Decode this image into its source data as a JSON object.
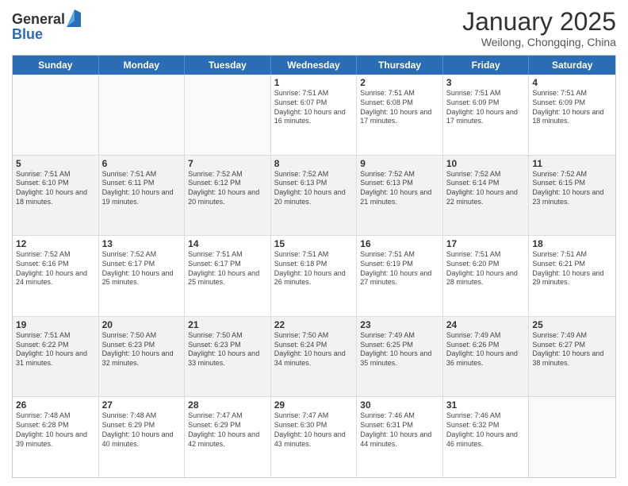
{
  "header": {
    "logo_general": "General",
    "logo_blue": "Blue",
    "month_title": "January 2025",
    "location": "Weilong, Chongqing, China"
  },
  "weekdays": [
    "Sunday",
    "Monday",
    "Tuesday",
    "Wednesday",
    "Thursday",
    "Friday",
    "Saturday"
  ],
  "rows": [
    [
      {
        "day": "",
        "info": ""
      },
      {
        "day": "",
        "info": ""
      },
      {
        "day": "",
        "info": ""
      },
      {
        "day": "1",
        "info": "Sunrise: 7:51 AM\nSunset: 6:07 PM\nDaylight: 10 hours and 16 minutes."
      },
      {
        "day": "2",
        "info": "Sunrise: 7:51 AM\nSunset: 6:08 PM\nDaylight: 10 hours and 17 minutes."
      },
      {
        "day": "3",
        "info": "Sunrise: 7:51 AM\nSunset: 6:09 PM\nDaylight: 10 hours and 17 minutes."
      },
      {
        "day": "4",
        "info": "Sunrise: 7:51 AM\nSunset: 6:09 PM\nDaylight: 10 hours and 18 minutes."
      }
    ],
    [
      {
        "day": "5",
        "info": "Sunrise: 7:51 AM\nSunset: 6:10 PM\nDaylight: 10 hours and 18 minutes."
      },
      {
        "day": "6",
        "info": "Sunrise: 7:51 AM\nSunset: 6:11 PM\nDaylight: 10 hours and 19 minutes."
      },
      {
        "day": "7",
        "info": "Sunrise: 7:52 AM\nSunset: 6:12 PM\nDaylight: 10 hours and 20 minutes."
      },
      {
        "day": "8",
        "info": "Sunrise: 7:52 AM\nSunset: 6:13 PM\nDaylight: 10 hours and 20 minutes."
      },
      {
        "day": "9",
        "info": "Sunrise: 7:52 AM\nSunset: 6:13 PM\nDaylight: 10 hours and 21 minutes."
      },
      {
        "day": "10",
        "info": "Sunrise: 7:52 AM\nSunset: 6:14 PM\nDaylight: 10 hours and 22 minutes."
      },
      {
        "day": "11",
        "info": "Sunrise: 7:52 AM\nSunset: 6:15 PM\nDaylight: 10 hours and 23 minutes."
      }
    ],
    [
      {
        "day": "12",
        "info": "Sunrise: 7:52 AM\nSunset: 6:16 PM\nDaylight: 10 hours and 24 minutes."
      },
      {
        "day": "13",
        "info": "Sunrise: 7:52 AM\nSunset: 6:17 PM\nDaylight: 10 hours and 25 minutes."
      },
      {
        "day": "14",
        "info": "Sunrise: 7:51 AM\nSunset: 6:17 PM\nDaylight: 10 hours and 25 minutes."
      },
      {
        "day": "15",
        "info": "Sunrise: 7:51 AM\nSunset: 6:18 PM\nDaylight: 10 hours and 26 minutes."
      },
      {
        "day": "16",
        "info": "Sunrise: 7:51 AM\nSunset: 6:19 PM\nDaylight: 10 hours and 27 minutes."
      },
      {
        "day": "17",
        "info": "Sunrise: 7:51 AM\nSunset: 6:20 PM\nDaylight: 10 hours and 28 minutes."
      },
      {
        "day": "18",
        "info": "Sunrise: 7:51 AM\nSunset: 6:21 PM\nDaylight: 10 hours and 29 minutes."
      }
    ],
    [
      {
        "day": "19",
        "info": "Sunrise: 7:51 AM\nSunset: 6:22 PM\nDaylight: 10 hours and 31 minutes."
      },
      {
        "day": "20",
        "info": "Sunrise: 7:50 AM\nSunset: 6:23 PM\nDaylight: 10 hours and 32 minutes."
      },
      {
        "day": "21",
        "info": "Sunrise: 7:50 AM\nSunset: 6:23 PM\nDaylight: 10 hours and 33 minutes."
      },
      {
        "day": "22",
        "info": "Sunrise: 7:50 AM\nSunset: 6:24 PM\nDaylight: 10 hours and 34 minutes."
      },
      {
        "day": "23",
        "info": "Sunrise: 7:49 AM\nSunset: 6:25 PM\nDaylight: 10 hours and 35 minutes."
      },
      {
        "day": "24",
        "info": "Sunrise: 7:49 AM\nSunset: 6:26 PM\nDaylight: 10 hours and 36 minutes."
      },
      {
        "day": "25",
        "info": "Sunrise: 7:49 AM\nSunset: 6:27 PM\nDaylight: 10 hours and 38 minutes."
      }
    ],
    [
      {
        "day": "26",
        "info": "Sunrise: 7:48 AM\nSunset: 6:28 PM\nDaylight: 10 hours and 39 minutes."
      },
      {
        "day": "27",
        "info": "Sunrise: 7:48 AM\nSunset: 6:29 PM\nDaylight: 10 hours and 40 minutes."
      },
      {
        "day": "28",
        "info": "Sunrise: 7:47 AM\nSunset: 6:29 PM\nDaylight: 10 hours and 42 minutes."
      },
      {
        "day": "29",
        "info": "Sunrise: 7:47 AM\nSunset: 6:30 PM\nDaylight: 10 hours and 43 minutes."
      },
      {
        "day": "30",
        "info": "Sunrise: 7:46 AM\nSunset: 6:31 PM\nDaylight: 10 hours and 44 minutes."
      },
      {
        "day": "31",
        "info": "Sunrise: 7:46 AM\nSunset: 6:32 PM\nDaylight: 10 hours and 46 minutes."
      },
      {
        "day": "",
        "info": ""
      }
    ]
  ]
}
